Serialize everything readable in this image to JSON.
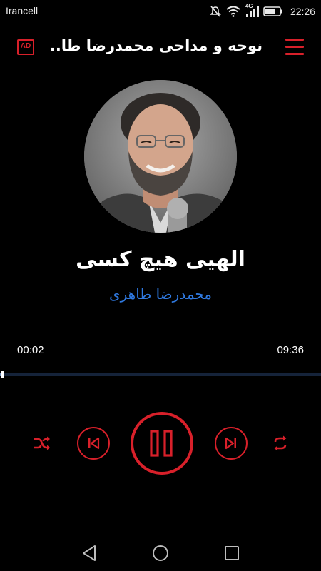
{
  "status_bar": {
    "carrier": "Irancell",
    "network": "4G",
    "time": "22:26"
  },
  "app_bar": {
    "title": "نوحه و مداحی محمدرضا طا...",
    "ad_label": "AD"
  },
  "now_playing": {
    "title": "الهیی هیچ کسی",
    "artist": "محمدرضا طاهری",
    "elapsed": "00:02",
    "duration": "09:36",
    "progress_fraction": 0.003
  },
  "colors": {
    "accent": "#d8202a",
    "artist": "#2f79e0",
    "background": "#000000"
  },
  "icons": {
    "ad": "ad-icon",
    "menu": "hamburger-menu-icon",
    "shuffle": "shuffle-icon",
    "previous": "skip-previous-icon",
    "play_pause": "pause-icon",
    "next": "skip-next-icon",
    "repeat": "repeat-icon"
  }
}
